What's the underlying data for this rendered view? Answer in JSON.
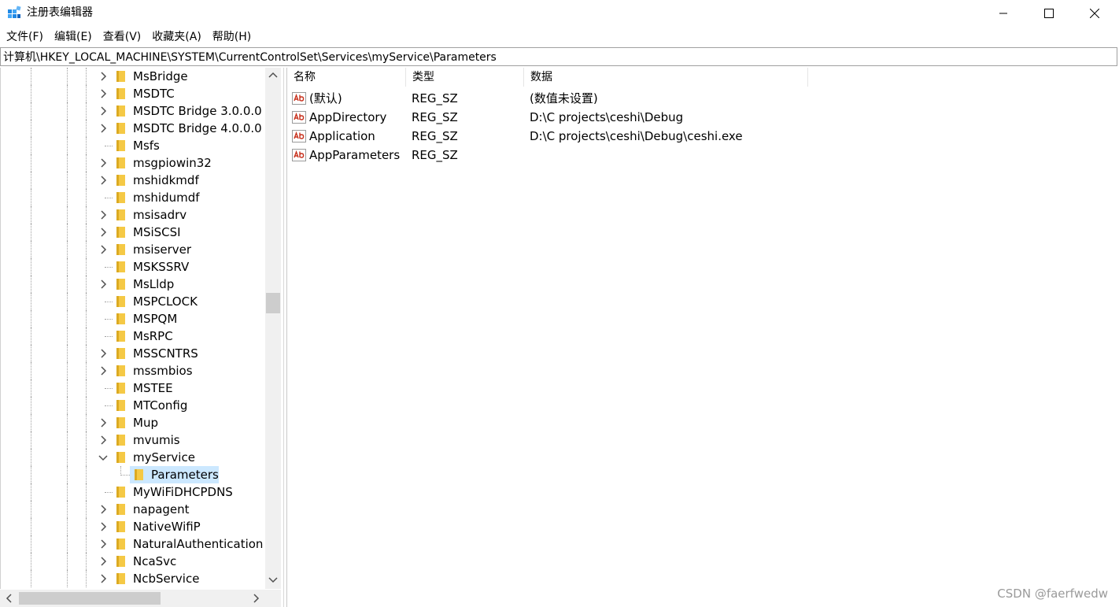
{
  "window": {
    "title": "注册表编辑器",
    "controls": {
      "minimize": "minimize",
      "maximize": "maximize",
      "close": "close"
    }
  },
  "menu": [
    "文件(F)",
    "编辑(E)",
    "查看(V)",
    "收藏夹(A)",
    "帮助(H)"
  ],
  "address": "计算机\\HKEY_LOCAL_MACHINE\\SYSTEM\\CurrentControlSet\\Services\\myService\\Parameters",
  "tree": {
    "items": [
      {
        "label": "MsBridge",
        "expander": "collapsed"
      },
      {
        "label": "MSDTC",
        "expander": "collapsed"
      },
      {
        "label": "MSDTC Bridge 3.0.0.0",
        "expander": "collapsed"
      },
      {
        "label": "MSDTC Bridge 4.0.0.0",
        "expander": "collapsed"
      },
      {
        "label": "Msfs",
        "expander": "none"
      },
      {
        "label": "msgpiowin32",
        "expander": "collapsed"
      },
      {
        "label": "mshidkmdf",
        "expander": "collapsed"
      },
      {
        "label": "mshidumdf",
        "expander": "none"
      },
      {
        "label": "msisadrv",
        "expander": "collapsed"
      },
      {
        "label": "MSiSCSI",
        "expander": "collapsed"
      },
      {
        "label": "msiserver",
        "expander": "collapsed"
      },
      {
        "label": "MSKSSRV",
        "expander": "none"
      },
      {
        "label": "MsLldp",
        "expander": "collapsed"
      },
      {
        "label": "MSPCLOCK",
        "expander": "none"
      },
      {
        "label": "MSPQM",
        "expander": "none"
      },
      {
        "label": "MsRPC",
        "expander": "none"
      },
      {
        "label": "MSSCNTRS",
        "expander": "collapsed"
      },
      {
        "label": "mssmbios",
        "expander": "collapsed"
      },
      {
        "label": "MSTEE",
        "expander": "none"
      },
      {
        "label": "MTConfig",
        "expander": "none"
      },
      {
        "label": "Mup",
        "expander": "collapsed"
      },
      {
        "label": "mvumis",
        "expander": "collapsed"
      },
      {
        "label": "myService",
        "expander": "expanded"
      },
      {
        "label": "Parameters",
        "expander": "child-selected"
      },
      {
        "label": "MyWiFiDHCPDNS",
        "expander": "none"
      },
      {
        "label": "napagent",
        "expander": "collapsed"
      },
      {
        "label": "NativeWifiP",
        "expander": "collapsed"
      },
      {
        "label": "NaturalAuthentication",
        "expander": "collapsed"
      },
      {
        "label": "NcaSvc",
        "expander": "collapsed"
      },
      {
        "label": "NcbService",
        "expander": "collapsed"
      }
    ]
  },
  "values": {
    "columns": [
      "名称",
      "类型",
      "数据"
    ],
    "rows": [
      {
        "name": "(默认)",
        "type": "REG_SZ",
        "data": "(数值未设置)"
      },
      {
        "name": "AppDirectory",
        "type": "REG_SZ",
        "data": "D:\\C projects\\ceshi\\Debug"
      },
      {
        "name": "Application",
        "type": "REG_SZ",
        "data": "D:\\C projects\\ceshi\\Debug\\ceshi.exe"
      },
      {
        "name": "AppParameters",
        "type": "REG_SZ",
        "data": ""
      }
    ]
  },
  "watermark": "CSDN @faerfwedw",
  "colors": {
    "selection": "#cce8ff",
    "folder": "#f5c945",
    "folder_dark": "#dcaa22",
    "value_icon_red": "#c8321e"
  }
}
